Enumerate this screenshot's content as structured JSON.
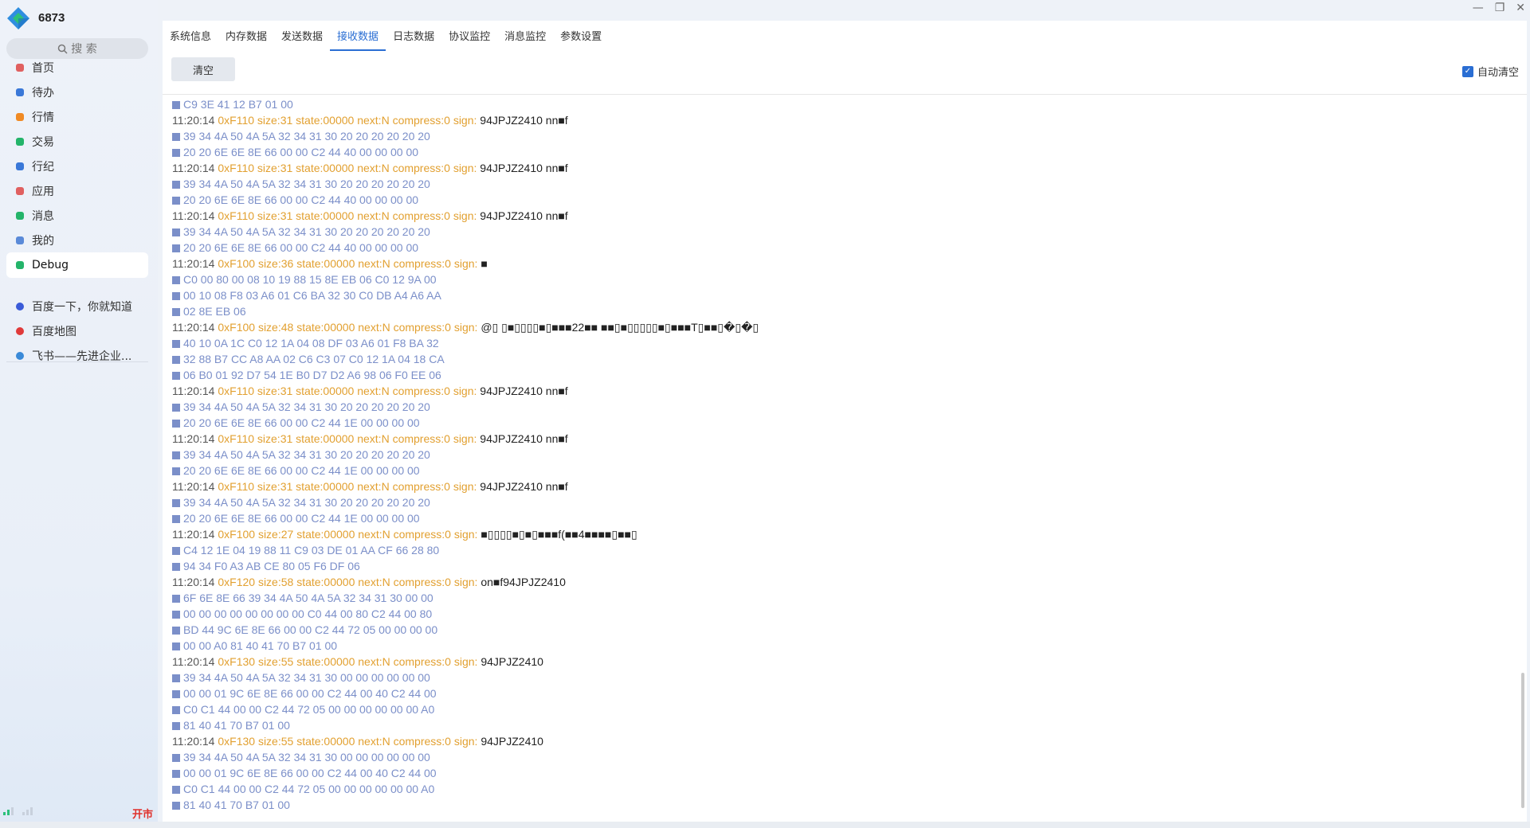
{
  "app": {
    "title": "6873"
  },
  "search": {
    "placeholder": "搜 索"
  },
  "nav": [
    {
      "label": "首页",
      "icon": "home-icon",
      "color": "#e06060"
    },
    {
      "label": "待办",
      "icon": "calendar-icon",
      "color": "#3a78d8"
    },
    {
      "label": "行情",
      "icon": "chart-icon",
      "color": "#f08a24"
    },
    {
      "label": "交易",
      "icon": "trade-icon",
      "color": "#24b46a"
    },
    {
      "label": "行纪",
      "icon": "user-icon",
      "color": "#3a78d8"
    },
    {
      "label": "应用",
      "icon": "apps-icon",
      "color": "#e06060"
    },
    {
      "label": "消息",
      "icon": "message-icon",
      "color": "#24b46a"
    },
    {
      "label": "我的",
      "icon": "profile-icon",
      "color": "#5a8ad8"
    },
    {
      "label": "Debug",
      "icon": "bug-icon",
      "color": "#24b46a"
    }
  ],
  "links": [
    {
      "label": "百度一下，你就知道",
      "icon": "baidu-icon",
      "color": "#3a5bd8"
    },
    {
      "label": "百度地图",
      "icon": "map-pin-icon",
      "color": "#e03a3a"
    },
    {
      "label": "飞书——先进企业...",
      "icon": "feishu-icon",
      "color": "#3a8ad8"
    }
  ],
  "status": {
    "market": "开市"
  },
  "tabs": [
    "系统信息",
    "内存数据",
    "发送数据",
    "接收数据",
    "日志数据",
    "协议监控",
    "消息监控",
    "参数设置"
  ],
  "active_tab": 3,
  "toolbar": {
    "clear_label": "清空",
    "auto_clear_label": "自动清空",
    "auto_clear_checked": true
  },
  "log": [
    {
      "type": "hex",
      "text": "C9 3E 41 12 B7 01 00"
    },
    {
      "type": "hdr",
      "time": "11:20:14",
      "meta": "0xF110 size:31 state:00000 next:N compress:0 sign:",
      "sign": "94JPJZ2410 nn■f"
    },
    {
      "type": "hex",
      "text": "39 34 4A 50 4A 5A 32 34 31 30 20 20 20 20 20 20"
    },
    {
      "type": "hex",
      "text": "20 20 6E 6E 8E 66 00 00 C2 44 40 00 00 00 00"
    },
    {
      "type": "hdr",
      "time": "11:20:14",
      "meta": "0xF110 size:31 state:00000 next:N compress:0 sign:",
      "sign": "94JPJZ2410 nn■f"
    },
    {
      "type": "hex",
      "text": "39 34 4A 50 4A 5A 32 34 31 30 20 20 20 20 20 20"
    },
    {
      "type": "hex",
      "text": "20 20 6E 6E 8E 66 00 00 C2 44 40 00 00 00 00"
    },
    {
      "type": "hdr",
      "time": "11:20:14",
      "meta": "0xF110 size:31 state:00000 next:N compress:0 sign:",
      "sign": "94JPJZ2410 nn■f"
    },
    {
      "type": "hex",
      "text": "39 34 4A 50 4A 5A 32 34 31 30 20 20 20 20 20 20"
    },
    {
      "type": "hex",
      "text": "20 20 6E 6E 8E 66 00 00 C2 44 40 00 00 00 00"
    },
    {
      "type": "hdr",
      "time": "11:20:14",
      "meta": "0xF100 size:36 state:00000 next:N compress:0 sign:",
      "sign": "■"
    },
    {
      "type": "hex",
      "text": "C0 00 80 00 08 10 19 88 15 8E EB 06 C0 12 9A 00"
    },
    {
      "type": "hex",
      "text": "00 10 08 F8 03 A6 01 C6 BA 32 30 C0 DB A4 A6 AA"
    },
    {
      "type": "hex",
      "text": "02 8E EB 06"
    },
    {
      "type": "hdr",
      "time": "11:20:14",
      "meta": "0xF100 size:48 state:00000 next:N compress:0 sign:",
      "sign": "@▯ ▯■▯▯▯▯■▯■■■22■■  ■■▯■▯▯▯▯▯■▯■■■T▯■■▯�▯�▯"
    },
    {
      "type": "hex",
      "text": "40 10 0A 1C C0 12 1A 04 08 DF 03 A6 01 F8 BA 32"
    },
    {
      "type": "hex",
      "text": "32 88 B7 CC A8 AA 02 C6 C3 07 C0 12 1A 04 18 CA"
    },
    {
      "type": "hex",
      "text": "06 B0 01 92 D7 54 1E B0 D7 D2 A6 98 06 F0 EE 06"
    },
    {
      "type": "hdr",
      "time": "11:20:14",
      "meta": "0xF110 size:31 state:00000 next:N compress:0 sign:",
      "sign": "94JPJZ2410 nn■f"
    },
    {
      "type": "hex",
      "text": "39 34 4A 50 4A 5A 32 34 31 30 20 20 20 20 20 20"
    },
    {
      "type": "hex",
      "text": "20 20 6E 6E 8E 66 00 00 C2 44 1E 00 00 00 00"
    },
    {
      "type": "hdr",
      "time": "11:20:14",
      "meta": "0xF110 size:31 state:00000 next:N compress:0 sign:",
      "sign": "94JPJZ2410 nn■f"
    },
    {
      "type": "hex",
      "text": "39 34 4A 50 4A 5A 32 34 31 30 20 20 20 20 20 20"
    },
    {
      "type": "hex",
      "text": "20 20 6E 6E 8E 66 00 00 C2 44 1E 00 00 00 00"
    },
    {
      "type": "hdr",
      "time": "11:20:14",
      "meta": "0xF110 size:31 state:00000 next:N compress:0 sign:",
      "sign": "94JPJZ2410 nn■f"
    },
    {
      "type": "hex",
      "text": "39 34 4A 50 4A 5A 32 34 31 30 20 20 20 20 20 20"
    },
    {
      "type": "hex",
      "text": "20 20 6E 6E 8E 66 00 00 C2 44 1E 00 00 00 00"
    },
    {
      "type": "hdr",
      "time": "11:20:14",
      "meta": "0xF100 size:27 state:00000 next:N compress:0 sign:",
      "sign": "■▯▯▯▯■▯■▯■■■f(■■4■■■■▯■■▯"
    },
    {
      "type": "hex",
      "text": "C4 12 1E 04 19 88 11 C9 03 DE 01 AA CF 66 28 80"
    },
    {
      "type": "hex",
      "text": "94 34 F0 A3 AB CE 80 05 F6 DF 06"
    },
    {
      "type": "hdr",
      "time": "11:20:14",
      "meta": "0xF120 size:58 state:00000 next:N compress:0 sign:",
      "sign": "on■f94JPJZ2410"
    },
    {
      "type": "hex",
      "text": "6F 6E 8E 66 39 34 4A 50 4A 5A 32 34 31 30 00 00"
    },
    {
      "type": "hex",
      "text": "00 00 00 00 00 00 00 00 C0 44 00 80 C2 44 00 80"
    },
    {
      "type": "hex",
      "text": "BD 44 9C 6E 8E 66 00 00 C2 44 72 05 00 00 00 00"
    },
    {
      "type": "hex",
      "text": "00 00 A0 81 40 41 70 B7 01 00"
    },
    {
      "type": "hdr",
      "time": "11:20:14",
      "meta": "0xF130 size:55 state:00000 next:N compress:0 sign:",
      "sign": "94JPJZ2410"
    },
    {
      "type": "hex",
      "text": "39 34 4A 50 4A 5A 32 34 31 30 00 00 00 00 00 00"
    },
    {
      "type": "hex",
      "text": "00 00 01 9C 6E 8E 66 00 00 C2 44 00 40 C2 44 00"
    },
    {
      "type": "hex",
      "text": "C0 C1 44 00 00 C2 44 72 05 00 00 00 00 00 00 A0"
    },
    {
      "type": "hex",
      "text": "81 40 41 70 B7 01 00"
    },
    {
      "type": "hdr",
      "time": "11:20:14",
      "meta": "0xF130 size:55 state:00000 next:N compress:0 sign:",
      "sign": "94JPJZ2410"
    },
    {
      "type": "hex",
      "text": "39 34 4A 50 4A 5A 32 34 31 30 00 00 00 00 00 00"
    },
    {
      "type": "hex",
      "text": "00 00 01 9C 6E 8E 66 00 00 C2 44 00 40 C2 44 00"
    },
    {
      "type": "hex",
      "text": "C0 C1 44 00 00 C2 44 72 05 00 00 00 00 00 00 A0"
    },
    {
      "type": "hex",
      "text": "81 40 41 70 B7 01 00"
    }
  ]
}
